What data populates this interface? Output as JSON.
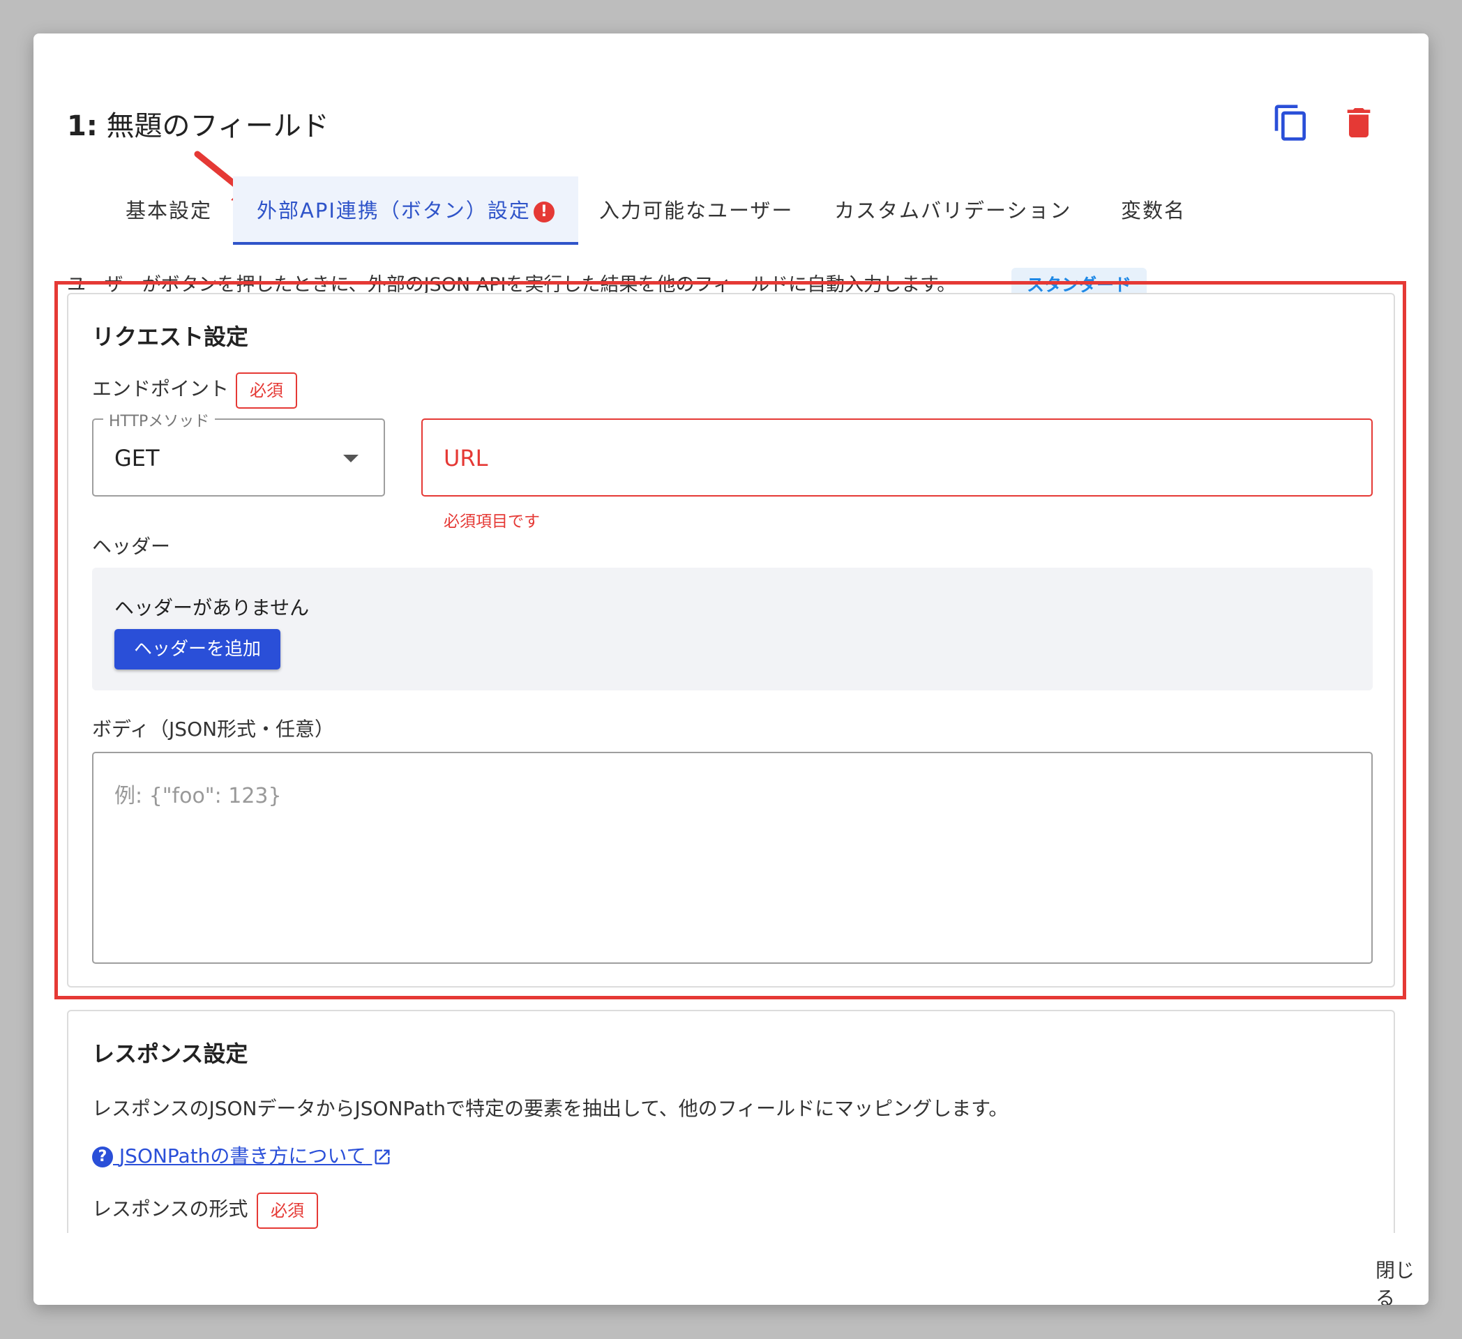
{
  "dialog": {
    "title_number": "1:",
    "title_text": "無題のフィールド",
    "copy_icon": "copy-icon",
    "delete_icon": "trash-icon",
    "close_label": "閉じる"
  },
  "tabs": [
    {
      "label": "基本設定"
    },
    {
      "label": "外部API連携（ボタン）設定",
      "error_mark": "!"
    },
    {
      "label": "入力可能なユーザー"
    },
    {
      "label": "カスタムバリデーション"
    },
    {
      "label": "変数名"
    }
  ],
  "description": "ユーザーがボタンを押したときに、外部のJSON APIを実行した結果を他のフィールドに自動入力します。",
  "plan_chip": "スタンダード",
  "request": {
    "title": "リクエスト設定",
    "endpoint_label": "エンドポイント",
    "required_badge": "必須",
    "method_legend": "HTTPメソッド",
    "method_value": "GET",
    "url_placeholder": "URL",
    "url_error": "必須項目です",
    "headers_label": "ヘッダー",
    "headers_empty": "ヘッダーがありません",
    "add_header_button": "ヘッダーを追加",
    "body_label": "ボディ（JSON形式・任意）",
    "body_placeholder": "例: {\"foo\": 123}"
  },
  "response": {
    "title": "レスポンス設定",
    "description": "レスポンスのJSONデータからJSONPathで特定の要素を抽出して、他のフィールドにマッピングします。",
    "help_icon_text": "?",
    "help_link": "JSONPathの書き方について",
    "format_label": "レスポンスの形式",
    "required_badge": "必須"
  },
  "colors": {
    "accent": "#2a4fd8",
    "error": "#e53935",
    "chip_bg": "#e7f1fb"
  }
}
